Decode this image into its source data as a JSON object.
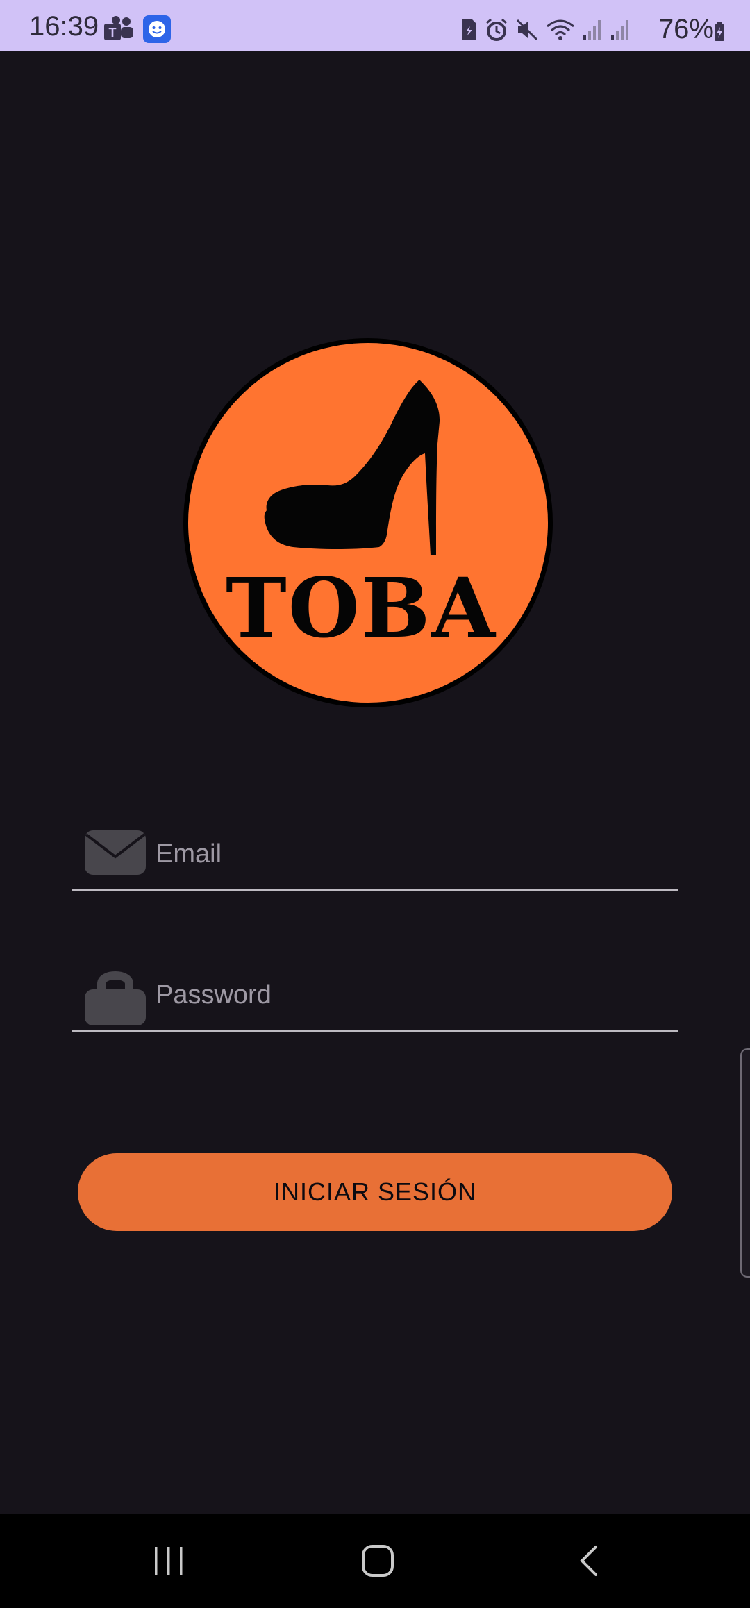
{
  "status_bar": {
    "time": "16:39",
    "battery_text": "76%",
    "left_icons": [
      "teams-icon",
      "assistant-face-icon"
    ],
    "right_icons": [
      "sim-card-icon",
      "alarm-icon",
      "mute-icon",
      "wifi-icon",
      "signal-icon",
      "signal-icon"
    ]
  },
  "logo": {
    "text": "TOBA",
    "icon": "high-heel-shoe-icon",
    "circle_color": "#ff7430"
  },
  "form": {
    "email": {
      "placeholder": "Email",
      "value": "",
      "icon": "envelope-icon"
    },
    "password": {
      "placeholder": "Password",
      "value": "",
      "icon": "lock-icon"
    },
    "submit_label": "INICIAR SESIÓN"
  },
  "colors": {
    "background": "#16131a",
    "accent": "#e87036",
    "status_bar": "#d1c2f7"
  },
  "nav_bar": {
    "buttons": [
      "recents-icon",
      "home-icon",
      "back-icon"
    ]
  }
}
